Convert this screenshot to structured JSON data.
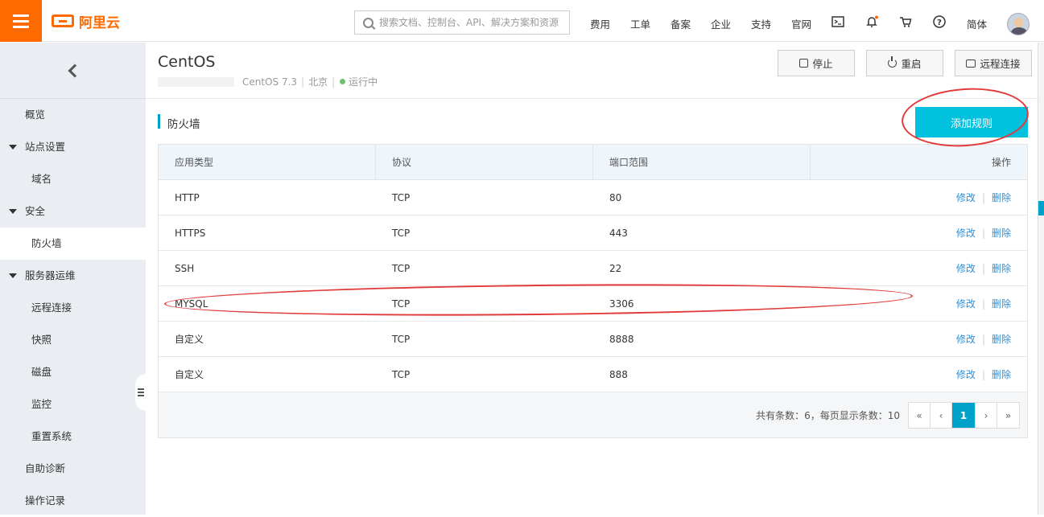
{
  "topbar": {
    "logo_text": "阿里云",
    "search_placeholder": "搜索文档、控制台、API、解决方案和资源",
    "nav": [
      "费用",
      "工单",
      "备案",
      "企业",
      "支持",
      "官网"
    ],
    "lang": "简体"
  },
  "sidebar": {
    "items": [
      {
        "label": "概览",
        "level": 1,
        "expandable": false
      },
      {
        "label": "站点设置",
        "level": 1,
        "expandable": true
      },
      {
        "label": "域名",
        "level": 2
      },
      {
        "label": "安全",
        "level": 1,
        "expandable": true
      },
      {
        "label": "防火墙",
        "level": 2,
        "active": true
      },
      {
        "label": "服务器运维",
        "level": 1,
        "expandable": true
      },
      {
        "label": "远程连接",
        "level": 2
      },
      {
        "label": "快照",
        "level": 2
      },
      {
        "label": "磁盘",
        "level": 2
      },
      {
        "label": "监控",
        "level": 2
      },
      {
        "label": "重置系统",
        "level": 2
      },
      {
        "label": "自助诊断",
        "level": 1
      },
      {
        "label": "操作记录",
        "level": 1
      }
    ]
  },
  "instance": {
    "title": "CentOS",
    "os": "CentOS 7.3",
    "region": "北京",
    "status": "运行中",
    "status_color": "#6cc36c"
  },
  "actions": {
    "stop": "停止",
    "restart": "重启",
    "remote": "远程连接"
  },
  "firewall": {
    "section_title": "防火墙",
    "add_button": "添加规则",
    "columns": [
      "应用类型",
      "协议",
      "端口范围",
      "操作"
    ],
    "rows": [
      {
        "app": "HTTP",
        "protocol": "TCP",
        "port": "80"
      },
      {
        "app": "HTTPS",
        "protocol": "TCP",
        "port": "443"
      },
      {
        "app": "SSH",
        "protocol": "TCP",
        "port": "22"
      },
      {
        "app": "MYSQL",
        "protocol": "TCP",
        "port": "3306"
      },
      {
        "app": "自定义",
        "protocol": "TCP",
        "port": "8888"
      },
      {
        "app": "自定义",
        "protocol": "TCP",
        "port": "888"
      }
    ],
    "edit_label": "修改",
    "delete_label": "删除",
    "pagination": {
      "summary": "共有条数：6，每页显示条数：10",
      "first": "«",
      "prev": "‹",
      "current": "1",
      "next": "›",
      "last": "»"
    }
  },
  "colors": {
    "brand": "#ff6a00",
    "accent": "#00c1de",
    "annotation": "#e23a3a"
  }
}
